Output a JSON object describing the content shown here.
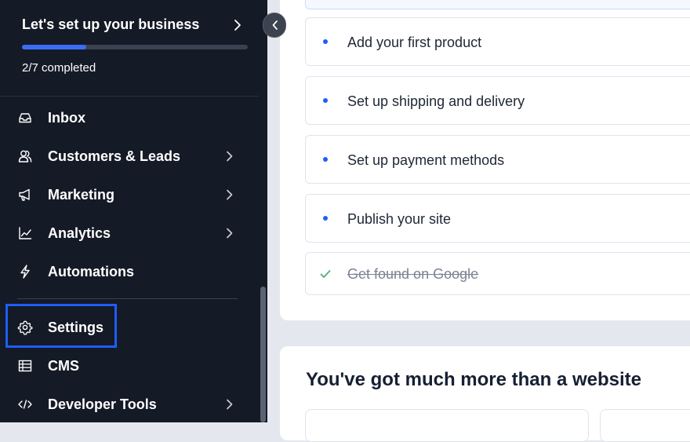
{
  "setup": {
    "title": "Let's set up your business",
    "progress_text": "2/7 completed",
    "progress_fraction": 0.2857
  },
  "nav": {
    "items": [
      {
        "label": "Inbox",
        "icon": "inbox-icon",
        "has_submenu": false
      },
      {
        "label": "Customers & Leads",
        "icon": "customers-icon",
        "has_submenu": true
      },
      {
        "label": "Marketing",
        "icon": "megaphone-icon",
        "has_submenu": true
      },
      {
        "label": "Analytics",
        "icon": "chart-icon",
        "has_submenu": true
      },
      {
        "label": "Automations",
        "icon": "lightning-icon",
        "has_submenu": false
      },
      {
        "label": "Settings",
        "icon": "gear-icon",
        "has_submenu": false,
        "highlighted": true
      },
      {
        "label": "CMS",
        "icon": "table-icon",
        "has_submenu": false
      },
      {
        "label": "Developer Tools",
        "icon": "code-icon",
        "has_submenu": true
      }
    ]
  },
  "tasks": [
    {
      "label": "Add your first product",
      "done": false
    },
    {
      "label": "Set up shipping and delivery",
      "done": false
    },
    {
      "label": "Set up payment methods",
      "done": false
    },
    {
      "label": "Publish your site",
      "done": false
    },
    {
      "label": "Get found on Google",
      "done": true
    }
  ],
  "main": {
    "section_title": "You've got much more than a website"
  },
  "colors": {
    "sidebar_bg": "#141a26",
    "accent": "#3b6cf6",
    "highlight_border": "#1e5eff",
    "done_check": "#4caf7d"
  }
}
